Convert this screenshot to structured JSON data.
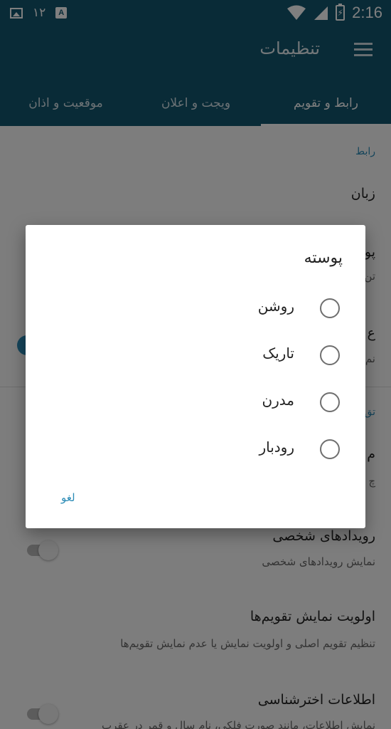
{
  "status_bar": {
    "notification_count": "۱۲",
    "time": "2:16",
    "battery_glyph": "⚡"
  },
  "app_bar": {
    "title": "تنظیمات"
  },
  "tabs": [
    {
      "label": "رابط و تقویم",
      "active": true
    },
    {
      "label": "ویجت و اعلان",
      "active": false
    },
    {
      "label": "موقعیت و اذان",
      "active": false
    }
  ],
  "settings": {
    "section_interface": "رابط",
    "language_title": "زبان",
    "partial_theme_title": "پو",
    "partial_theme_sub": "تن",
    "partial_row3_title": "ع",
    "partial_row3_sub": "نم",
    "partial_section2": "تق",
    "partial_row4_title": "م",
    "partial_row4_sub": "چ",
    "personal_events_title": "رویدادهای شخصی",
    "personal_events_sub": "نمایش رویدادهای شخصی",
    "calendar_priority_title": "اولویت نمایش تقویم‌ها",
    "calendar_priority_sub": "تنظیم تقویم اصلی و اولویت نمایش یا عدم نمایش تقویم‌ها",
    "astronomy_title": "اطلاعات اخترشناسی",
    "astronomy_sub": "نمایش اطلاعات، مانند صورت فلکی، نام سال و قمر در عقرب"
  },
  "dialog": {
    "title": "پوسته",
    "options": [
      {
        "label": "روشن",
        "selected": false
      },
      {
        "label": "تاریک",
        "selected": false
      },
      {
        "label": "مدرن",
        "selected": false
      },
      {
        "label": "رودبار",
        "selected": false
      }
    ],
    "cancel_label": "لغو"
  },
  "colors": {
    "primary": "#12566f",
    "accent": "#2a8bb6"
  }
}
